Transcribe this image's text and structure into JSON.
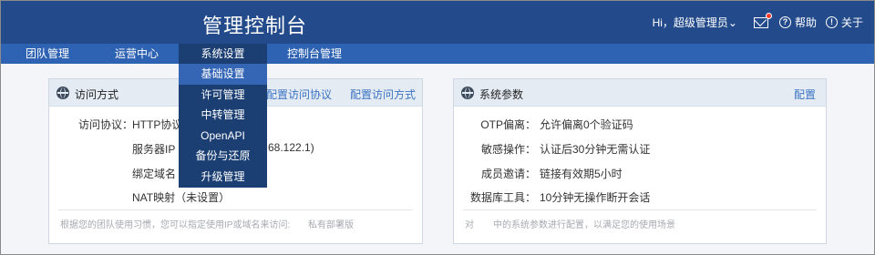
{
  "header": {
    "title": "管理控制台",
    "greeting": "Hi，超级管理员",
    "greeting_caret": "⌄",
    "help_label": "帮助",
    "about_label": "关于",
    "help_icon_glyph": "?",
    "about_icon_glyph": "!"
  },
  "nav": {
    "items": [
      {
        "label": "团队管理"
      },
      {
        "label": "运营中心"
      },
      {
        "label": "系统设置"
      },
      {
        "label": "控制台管理"
      }
    ]
  },
  "dropdown": {
    "items": [
      {
        "label": "基础设置"
      },
      {
        "label": "许可管理"
      },
      {
        "label": "中转管理"
      },
      {
        "label": "OpenAPI"
      },
      {
        "label": "备份与还原"
      },
      {
        "label": "升级管理"
      }
    ]
  },
  "access_panel": {
    "title": "访问方式",
    "link_view": "配置访问协议",
    "link_config": "配置访问方式",
    "protocol_label": "访问协议：",
    "protocol_value": "HTTP协议,",
    "server_ip_label": "服务器IP（",
    "server_ip_tail": "68.122.1)",
    "domain_label": "绑定域名（",
    "nat_label": "NAT映射（未设置）",
    "footer_left": "根据您的团队使用习惯，您可以指定使用IP或域名来访问:",
    "footer_right": "私有部署版"
  },
  "system_panel": {
    "title": "系统参数",
    "config_link": "配置",
    "rows": [
      {
        "label": "OTP偏离：",
        "value": "允许偏离0个验证码"
      },
      {
        "label": "敏感操作：",
        "value": "认证后30分钟无需认证"
      },
      {
        "label": "成员邀请：",
        "value": "链接有效期5小时"
      },
      {
        "label": "数据库工具：",
        "value": "10分钟无操作断开会话"
      }
    ],
    "footer_left": "对",
    "footer_right": "中的系统参数进行配置，以满足您的使用场景"
  },
  "colors": {
    "header_bg": "#234b8b",
    "nav_bg": "#2e62b2",
    "nav_active": "#1b3f73",
    "dropdown_highlight": "#3566b5",
    "link": "#3b73c3",
    "panel_head": "#e4ebf3"
  },
  "icons": [
    "mail-icon",
    "help-icon",
    "info-icon",
    "globe-icon"
  ]
}
